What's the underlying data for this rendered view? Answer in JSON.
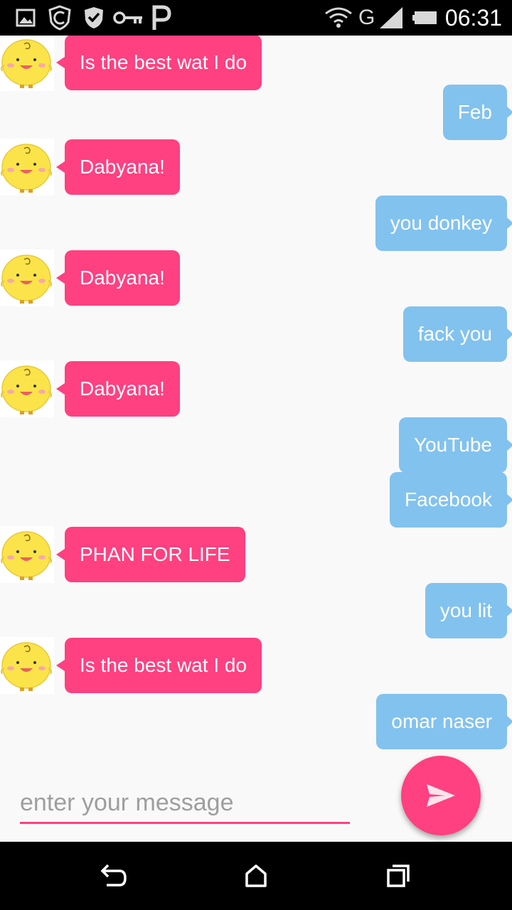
{
  "status_bar": {
    "time": "06:31",
    "network": "G",
    "icons": [
      "image-icon",
      "shield-icon",
      "checkmark-shield-icon",
      "key-icon",
      "p-icon",
      "wifi-icon",
      "signal-icon",
      "battery-icon"
    ]
  },
  "messages": [
    {
      "sender": "bot",
      "text": "Is the best wat I do"
    },
    {
      "sender": "user",
      "text": "Feb"
    },
    {
      "sender": "bot",
      "text": "Dabyana!"
    },
    {
      "sender": "user",
      "text": "you donkey"
    },
    {
      "sender": "bot",
      "text": "Dabyana!"
    },
    {
      "sender": "user",
      "text": "fack you"
    },
    {
      "sender": "bot",
      "text": "Dabyana!"
    },
    {
      "sender": "user",
      "text": "YouTube"
    },
    {
      "sender": "user",
      "text": "Facebook"
    },
    {
      "sender": "bot",
      "text": "PHAN FOR LIFE"
    },
    {
      "sender": "user",
      "text": "you lit"
    },
    {
      "sender": "bot",
      "text": "Is the best wat I do"
    },
    {
      "sender": "user",
      "text": "omar naser"
    }
  ],
  "composer": {
    "placeholder": "enter your message",
    "value": ""
  },
  "nav_bar": {
    "icons": [
      "back-icon",
      "home-icon",
      "recents-icon"
    ]
  },
  "colors": {
    "bot_bubble": "#ff4081",
    "user_bubble": "#82c2ee",
    "accent": "#ff4081"
  }
}
